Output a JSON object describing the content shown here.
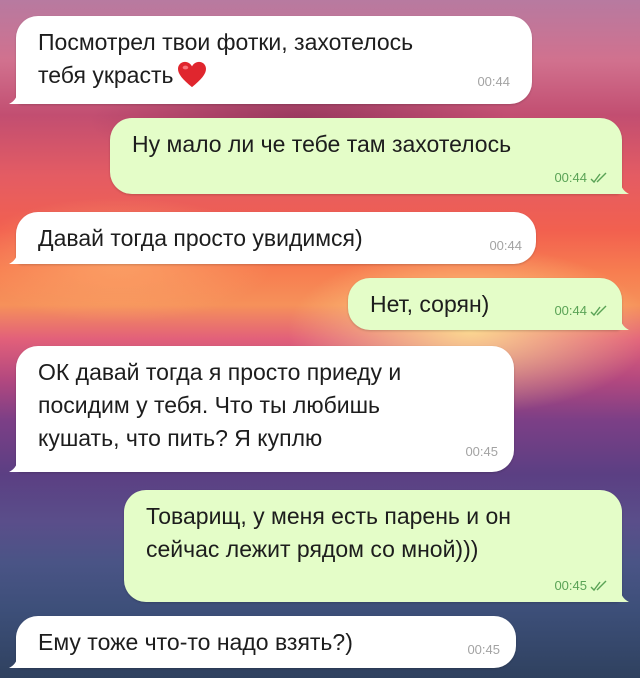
{
  "messages": [
    {
      "direction": "in",
      "text": "Посмотрел твои фотки, захотелось\nтебя украсть",
      "time": "00:44",
      "emoji": "red-heart"
    },
    {
      "direction": "out",
      "text": "Ну мало ли че тебе там захотелось",
      "time": "00:44",
      "status": "read"
    },
    {
      "direction": "in",
      "text": "Давай тогда просто увидимся)",
      "time": "00:44"
    },
    {
      "direction": "out",
      "text": "Нет, сорян)",
      "time": "00:44",
      "status": "read"
    },
    {
      "direction": "in",
      "text": "ОК давай тогда я просто приеду и\nпосидим у тебя. Что ты любишь\nкушать, что пить? Я куплю",
      "time": "00:45"
    },
    {
      "direction": "out",
      "text": "Товарищ, у меня есть парень и он\nсейчас лежит рядом со мной)))",
      "time": "00:45",
      "status": "read"
    },
    {
      "direction": "in",
      "text": "Ему тоже что-то надо взять?)",
      "time": "00:45"
    }
  ],
  "colors": {
    "incoming_bubble": "#ffffff",
    "outgoing_bubble": "#e4fdc8",
    "incoming_time": "#a3a3a3",
    "outgoing_time": "#5aa356",
    "heart": "#e0262e"
  }
}
